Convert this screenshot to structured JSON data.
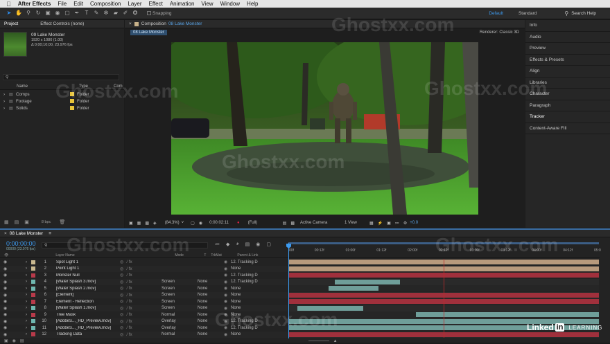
{
  "menu": [
    "After Effects",
    "File",
    "Edit",
    "Composition",
    "Layer",
    "Effect",
    "Animation",
    "View",
    "Window",
    "Help"
  ],
  "toolbar": {
    "snapping": "Snapping",
    "workspaces": [
      "Default",
      "Standard"
    ],
    "search": "Search Help"
  },
  "project": {
    "tabs": [
      "Project",
      "Effect Controls (none)"
    ],
    "comp_name": "09 Lake Monster",
    "comp_size": "1920 x 1080 (1.00)",
    "comp_dur": "Δ 0;00;10;00, 23.976 fps",
    "cols": [
      "Name",
      "Type",
      "Com"
    ],
    "items": [
      {
        "name": "Comps",
        "type": "Folder",
        "color": "#e8c43a"
      },
      {
        "name": "Footage",
        "type": "Folder",
        "color": "#e8c43a"
      },
      {
        "name": "Solids",
        "type": "Folder",
        "color": "#e8c43a"
      }
    ],
    "bpc": "8 bpc"
  },
  "viewer": {
    "tab_prefix": "Composition",
    "comp": "08 Lake Monster",
    "subtab": "08 Lake Monster",
    "renderer": "Renderer:",
    "renderer_val": "Classic 3D",
    "zoom": "(84.3%)",
    "timecode": "0:00:02:11",
    "res": "(Full)",
    "camera": "Active Camera",
    "view": "1 View",
    "exposure": "+0.0"
  },
  "right_panels": [
    "Info",
    "Audio",
    "Preview",
    "Effects & Presets",
    "Align",
    "Libraries",
    "Character",
    "Paragraph",
    "Tracker",
    "Content-Aware Fill"
  ],
  "timeline": {
    "tab": "08 Lake Monster",
    "timecode": "0:00:00:00",
    "timecode_sub": "00000 (23.976 fps)",
    "cols": {
      "name": "Layer Name",
      "mode": "Mode",
      "t": "T",
      "trkmat": "TrkMat",
      "parent": "Parent & Link"
    },
    "ruler": [
      "00f",
      "00:12f",
      "01:00f",
      "01:12f",
      "02:00f",
      "02:12f",
      "03:00f",
      "03:12f",
      "04:00f",
      "04:12f",
      "05:0"
    ],
    "layers": [
      {
        "n": "1",
        "name": "Spot Light 1",
        "color": "#c9b88f",
        "mode": "",
        "trk": "",
        "parent": "12. Tracking D",
        "bar_start": 0,
        "bar_end": 1,
        "bar_color": "#b89a7c"
      },
      {
        "n": "2",
        "name": "Point Light 1",
        "color": "#c9b88f",
        "mode": "",
        "trk": "",
        "parent": "None",
        "bar_start": 0,
        "bar_end": 1,
        "bar_color": "#b89a7c"
      },
      {
        "n": "3",
        "name": "Monster Null",
        "color": "#b83a4a",
        "mode": "",
        "trk": "",
        "parent": "12. Tracking D",
        "bar_start": 0,
        "bar_end": 1,
        "bar_color": "#a0303c"
      },
      {
        "n": "4",
        "name": "[Water Splash 3.mov]",
        "color": "#6fb8b0",
        "mode": "Screen",
        "trk": "None",
        "parent": "12. Tracking D",
        "bar_start": 0.15,
        "bar_end": 0.36,
        "bar_color": "#6f9e99"
      },
      {
        "n": "5",
        "name": "[Water Splash 2.mov]",
        "color": "#6fb8b0",
        "mode": "Screen",
        "trk": "None",
        "parent": "None",
        "bar_start": 0.13,
        "bar_end": 0.29,
        "bar_color": "#6f9e99"
      },
      {
        "n": "6",
        "name": "[Element]",
        "color": "#b83a4a",
        "mode": "Screen",
        "trk": "None",
        "parent": "None",
        "bar_start": 0,
        "bar_end": 1,
        "bar_color": "#a0303c"
      },
      {
        "n": "7",
        "name": "Element - Reflection",
        "color": "#b83a4a",
        "mode": "Screen",
        "trk": "None",
        "parent": "None",
        "bar_start": 0,
        "bar_end": 1,
        "bar_color": "#a0303c"
      },
      {
        "n": "8",
        "name": "[Water Splash 1.mov]",
        "color": "#6fb8b0",
        "mode": "Screen",
        "trk": "None",
        "parent": "None",
        "bar_start": 0.03,
        "bar_end": 0.24,
        "bar_color": "#6f9e99"
      },
      {
        "n": "9",
        "name": "Tree Mask",
        "color": "#b83a4a",
        "mode": "Normal",
        "trk": "None",
        "parent": "None",
        "bar_start": 0.41,
        "bar_end": 1,
        "bar_color": "#6f9e99"
      },
      {
        "n": "10",
        "name": "[AdobeS..._HD_Preview.mov]",
        "color": "#6fb8b0",
        "mode": "Overlay",
        "trk": "None",
        "parent": "12. Tracking D",
        "bar_start": 0,
        "bar_end": 1,
        "bar_color": "#6f9e99"
      },
      {
        "n": "11",
        "name": "[AdobeS..._HD_Preview.mov]",
        "color": "#6fb8b0",
        "mode": "Overlay",
        "trk": "None",
        "parent": "12. Tracking D",
        "bar_start": 0,
        "bar_end": 1,
        "bar_color": "#6f9e99"
      },
      {
        "n": "12",
        "name": "Tracking Data",
        "color": "#b83a4a",
        "mode": "Normal",
        "trk": "None",
        "parent": "None",
        "bar_start": 0,
        "bar_end": 1,
        "bar_color": "#a0303c"
      }
    ]
  },
  "watermark": "Ghostxx.com",
  "branding": {
    "linkedin": "Linked",
    "in": "in",
    "learning": "LEARNING"
  }
}
